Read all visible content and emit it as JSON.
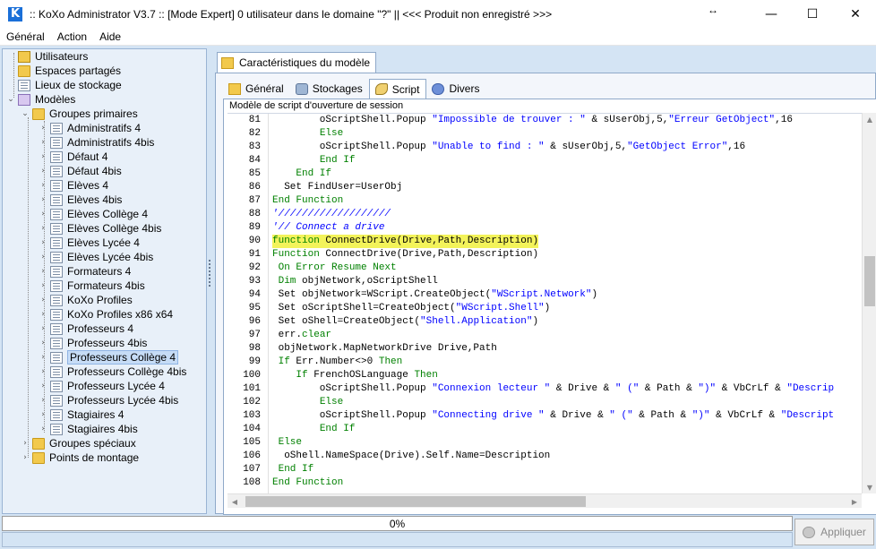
{
  "window": {
    "title": ":: KoXo Administrator V3.7 :: [Mode Expert] 0 utilisateur dans le domaine \"?\" || <<< Produit non enregistré >>>",
    "app_icon_glyph": "K",
    "resize_glyph": "↔",
    "minimize_glyph": "—",
    "maximize_glyph": "☐",
    "close_glyph": "✕"
  },
  "menu": [
    "Général",
    "Action",
    "Aide"
  ],
  "tree": {
    "roots": [
      {
        "label": "Utilisateurs",
        "icon": "users-icon"
      },
      {
        "label": "Espaces partagés",
        "icon": "shares-icon"
      },
      {
        "label": "Lieux de stockage",
        "icon": "storage-icon"
      },
      {
        "label": "Modèles",
        "icon": "models-icon"
      }
    ],
    "groups_primary_label": "Groupes primaires",
    "primary_groups": [
      "Administratifs 4",
      "Administratifs 4bis",
      "Défaut 4",
      "Défaut 4bis",
      "Elèves 4",
      "Elèves 4bis",
      "Elèves Collège 4",
      "Elèves Collège 4bis",
      "Elèves Lycée 4",
      "Elèves Lycée 4bis",
      "Formateurs 4",
      "Formateurs 4bis",
      "KoXo Profiles",
      "KoXo Profiles x86 x64",
      "Professeurs 4",
      "Professeurs 4bis",
      "Professeurs Collège 4",
      "Professeurs Collège 4bis",
      "Professeurs Lycée 4",
      "Professeurs Lycée 4bis",
      "Stagiaires 4",
      "Stagiaires 4bis"
    ],
    "selected": "Professeurs Collège 4",
    "groups_special_label": "Groupes spéciaux",
    "mount_points_label": "Points de montage"
  },
  "panel": {
    "outer_tab": "Caractéristiques du modèle",
    "tabs": [
      {
        "label": "Général",
        "icon": "general-icon"
      },
      {
        "label": "Stockages",
        "icon": "storage-icon"
      },
      {
        "label": "Script",
        "icon": "script-icon"
      },
      {
        "label": "Divers",
        "icon": "divers-icon"
      }
    ],
    "active_tab": "Script",
    "editor_caption": "Modèle de script d'ouverture de session"
  },
  "code": {
    "line_numbers": [
      81,
      82,
      83,
      84,
      85,
      86,
      87,
      88,
      89,
      90,
      91,
      92,
      93,
      94,
      95,
      96,
      97,
      98,
      99,
      100,
      101,
      102,
      103,
      104,
      105,
      106,
      107,
      108
    ],
    "highlighted_line": 90,
    "lines": [
      [
        [
          "t",
          "        oScriptShell.Popup "
        ],
        [
          "s",
          "\"Impossible de trouver : \""
        ],
        [
          "t",
          " & sUserObj,5,"
        ],
        [
          "s",
          "\"Erreur GetObject\""
        ],
        [
          "t",
          ",16"
        ]
      ],
      [
        [
          "t",
          "        "
        ],
        [
          "k",
          "Else"
        ]
      ],
      [
        [
          "t",
          "        oScriptShell.Popup "
        ],
        [
          "s",
          "\"Unable to find : \""
        ],
        [
          "t",
          " & sUserObj,5,"
        ],
        [
          "s",
          "\"GetObject Error\""
        ],
        [
          "t",
          ",16"
        ]
      ],
      [
        [
          "t",
          "        "
        ],
        [
          "k",
          "End If"
        ]
      ],
      [
        [
          "t",
          "    "
        ],
        [
          "k",
          "End If"
        ]
      ],
      [
        [
          "t",
          "  Set FindUser=UserObj"
        ]
      ],
      [
        [
          "k",
          "End Function"
        ]
      ],
      [
        [
          "c",
          "'///////////////////"
        ]
      ],
      [
        [
          "c",
          "'// Connect a drive"
        ]
      ],
      [
        [
          "k",
          "function"
        ],
        [
          "t",
          " ConnectDrive(Drive,Path,Description)"
        ]
      ],
      [
        [
          "k",
          "Function"
        ],
        [
          "t",
          " ConnectDrive(Drive,Path,Description)"
        ]
      ],
      [
        [
          "t",
          " "
        ],
        [
          "k",
          "On Error Resume Next"
        ]
      ],
      [
        [
          "t",
          " "
        ],
        [
          "k",
          "Dim"
        ],
        [
          "t",
          " objNetwork,oScriptShell"
        ]
      ],
      [
        [
          "t",
          " Set objNetwork=WScript.CreateObject("
        ],
        [
          "s",
          "\"WScript.Network\""
        ],
        [
          "t",
          ")"
        ]
      ],
      [
        [
          "t",
          " Set oScriptShell=CreateObject("
        ],
        [
          "s",
          "\"WScript.Shell\""
        ],
        [
          "t",
          ")"
        ]
      ],
      [
        [
          "t",
          " Set oShell=CreateObject("
        ],
        [
          "s",
          "\"Shell.Application\""
        ],
        [
          "t",
          ")"
        ]
      ],
      [
        [
          "t",
          " err."
        ],
        [
          "k",
          "clear"
        ]
      ],
      [
        [
          "t",
          " objNetwork.MapNetworkDrive Drive,Path"
        ]
      ],
      [
        [
          "t",
          " "
        ],
        [
          "k",
          "If"
        ],
        [
          "t",
          " Err.Number<>0 "
        ],
        [
          "k",
          "Then"
        ]
      ],
      [
        [
          "t",
          "    "
        ],
        [
          "k",
          "If"
        ],
        [
          "t",
          " FrenchOSLanguage "
        ],
        [
          "k",
          "Then"
        ]
      ],
      [
        [
          "t",
          "        oScriptShell.Popup "
        ],
        [
          "s",
          "\"Connexion lecteur \""
        ],
        [
          "t",
          " & Drive & "
        ],
        [
          "s",
          "\" (\""
        ],
        [
          "t",
          " & Path & "
        ],
        [
          "s",
          "\")\""
        ],
        [
          "t",
          " & VbCrLf & "
        ],
        [
          "s",
          "\"Descrip"
        ]
      ],
      [
        [
          "t",
          "        "
        ],
        [
          "k",
          "Else"
        ]
      ],
      [
        [
          "t",
          "        oScriptShell.Popup "
        ],
        [
          "s",
          "\"Connecting drive \""
        ],
        [
          "t",
          " & Drive & "
        ],
        [
          "s",
          "\" (\""
        ],
        [
          "t",
          " & Path & "
        ],
        [
          "s",
          "\")\""
        ],
        [
          "t",
          " & VbCrLf & "
        ],
        [
          "s",
          "\"Descript"
        ]
      ],
      [
        [
          "t",
          "        "
        ],
        [
          "k",
          "End If"
        ]
      ],
      [
        [
          "t",
          " "
        ],
        [
          "k",
          "Else"
        ]
      ],
      [
        [
          "t",
          "  oShell.NameSpace(Drive).Self.Name=Description"
        ]
      ],
      [
        [
          "t",
          " "
        ],
        [
          "k",
          "End If"
        ]
      ],
      [
        [
          "k",
          "End Function"
        ]
      ]
    ]
  },
  "progress": {
    "label": "0%",
    "value": 0
  },
  "apply_button": "Appliquer"
}
